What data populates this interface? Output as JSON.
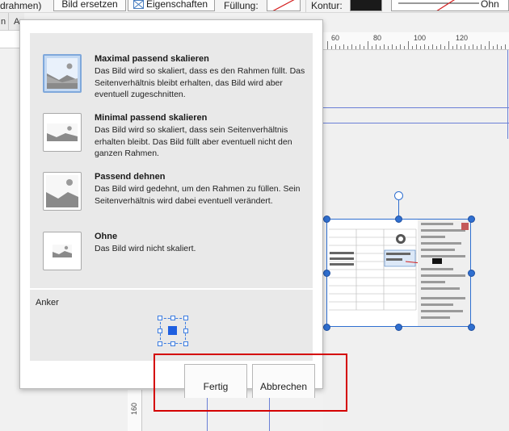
{
  "toolbar": {
    "frame_label": "drahmen)",
    "replace_image_button": "Bild ersetzen",
    "properties_button": "Eigenschaften",
    "fill_label": "Füllung:",
    "outline_label": "Kontur:",
    "stroke_value": "Ohn"
  },
  "tabs": {
    "first": "n",
    "second": "A"
  },
  "ruler": {
    "ticks": [
      "60",
      "80",
      "100",
      "120"
    ]
  },
  "vertical_ruler": {
    "tick": "160"
  },
  "popup": {
    "options": [
      {
        "title": "Maximal passend skalieren",
        "description": "Das Bild wird so skaliert, dass es den Rahmen füllt. Das Seitenverhältnis bleibt erhalten, das Bild wird aber eventuell zugeschnitten.",
        "icon": "scale-max-icon",
        "selected": true
      },
      {
        "title": "Minimal passend skalieren",
        "description": "Das Bild wird so skaliert, dass sein Seitenverhältnis erhalten bleibt. Das Bild füllt aber eventuell nicht den ganzen Rahmen.",
        "icon": "scale-min-icon",
        "selected": false
      },
      {
        "title": "Passend dehnen",
        "description": "Das Bild wird gedehnt, um den Rahmen zu füllen. Sein Seitenverhältnis wird dabei eventuell verändert.",
        "icon": "stretch-icon",
        "selected": false
      },
      {
        "title": "Ohne",
        "description": "Das Bild wird nicht skaliert.",
        "icon": "no-scale-icon",
        "selected": false
      }
    ],
    "anchor_label": "Anker",
    "done_button": "Fertig",
    "cancel_button": "Abbrechen"
  },
  "colors": {
    "accent": "#2f6fd0",
    "highlight": "#d40000",
    "selected_thumb": "#c4d9f3"
  }
}
